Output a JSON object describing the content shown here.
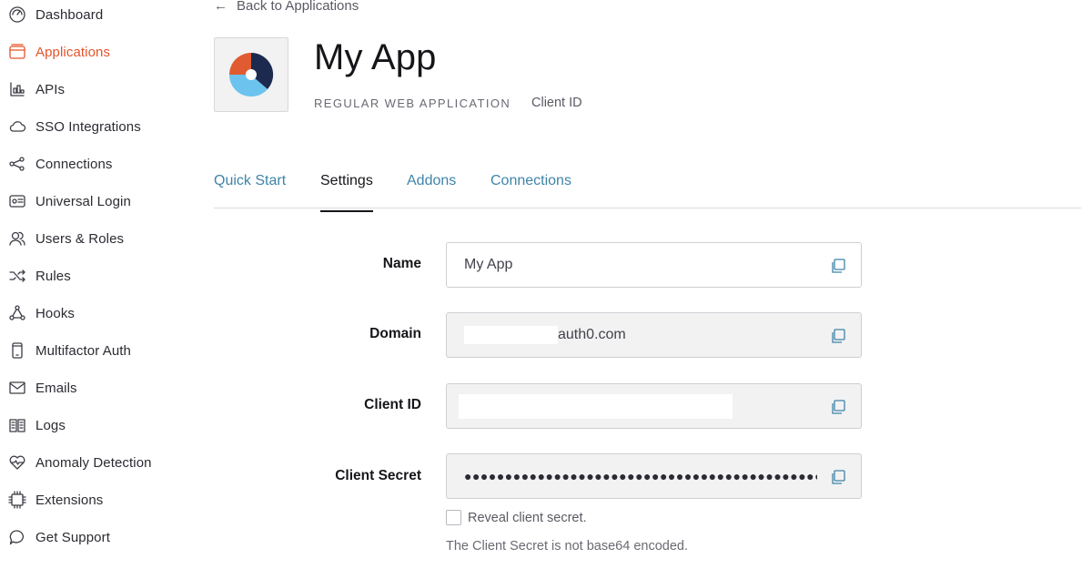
{
  "sidebar": {
    "items": [
      {
        "label": "Dashboard",
        "icon": "dashboard-icon",
        "active": false
      },
      {
        "label": "Applications",
        "icon": "applications-icon",
        "active": true
      },
      {
        "label": "APIs",
        "icon": "apis-icon",
        "active": false
      },
      {
        "label": "SSO Integrations",
        "icon": "cloud-icon",
        "active": false
      },
      {
        "label": "Connections",
        "icon": "connections-icon",
        "active": false
      },
      {
        "label": "Universal Login",
        "icon": "universal-login-icon",
        "active": false
      },
      {
        "label": "Users & Roles",
        "icon": "users-icon",
        "active": false
      },
      {
        "label": "Rules",
        "icon": "rules-icon",
        "active": false
      },
      {
        "label": "Hooks",
        "icon": "hooks-icon",
        "active": false
      },
      {
        "label": "Multifactor Auth",
        "icon": "phone-icon",
        "active": false
      },
      {
        "label": "Emails",
        "icon": "mail-icon",
        "active": false
      },
      {
        "label": "Logs",
        "icon": "logs-icon",
        "active": false
      },
      {
        "label": "Anomaly Detection",
        "icon": "heart-pulse-icon",
        "active": false
      },
      {
        "label": "Extensions",
        "icon": "chip-icon",
        "active": false
      },
      {
        "label": "Get Support",
        "icon": "chat-bubble-icon",
        "active": false
      }
    ]
  },
  "header": {
    "back_label": "Back to Applications",
    "back_icon": "arrow-left-icon",
    "app_name": "My App",
    "app_type": "REGULAR WEB APPLICATION",
    "client_id_label": "Client ID"
  },
  "tabs": [
    {
      "label": "Quick Start",
      "active": false
    },
    {
      "label": "Settings",
      "active": true
    },
    {
      "label": "Addons",
      "active": false
    },
    {
      "label": "Connections",
      "active": false
    }
  ],
  "form": {
    "name": {
      "label": "Name",
      "value": "My App"
    },
    "domain": {
      "label": "Domain",
      "value_suffix": "auth0.com"
    },
    "client_id": {
      "label": "Client ID",
      "value": ""
    },
    "client_secret": {
      "label": "Client Secret",
      "value": "●●●●●●●●●●●●●●●●●●●●●●●●●●●●●●●●●●●●●●●●●●●●●●●●●●●●●●●●●●●●●●●●"
    },
    "reveal_label": "Reveal client secret.",
    "help_text": "The Client Secret is not base64 encoded."
  },
  "colors": {
    "accent": "#e5532b",
    "link": "#3f84a8",
    "logo_orange": "#e15b32",
    "logo_navy": "#1b2a4e",
    "logo_blue": "#6cc3ee"
  }
}
